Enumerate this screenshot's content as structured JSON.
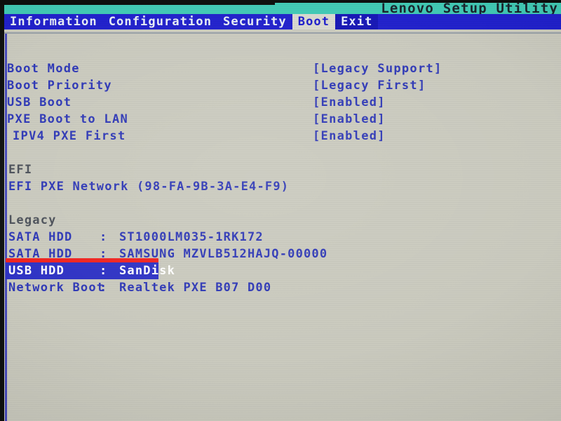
{
  "window": {
    "title": "Lenovo Setup Utility"
  },
  "menu": {
    "items": [
      {
        "label": "Information",
        "state": "normal"
      },
      {
        "label": "Configuration",
        "state": "normal"
      },
      {
        "label": "Security",
        "state": "normal"
      },
      {
        "label": "Boot",
        "state": "active"
      },
      {
        "label": "Exit",
        "state": "focus"
      }
    ]
  },
  "settings": [
    {
      "label": "Boot Mode",
      "value": "[Legacy Support]"
    },
    {
      "label": "Boot Priority",
      "value": "[Legacy First]"
    },
    {
      "label": "USB Boot",
      "value": "[Enabled]"
    },
    {
      "label": "PXE Boot to LAN",
      "value": "[Enabled]"
    },
    {
      "label": "IPV4 PXE First",
      "value": "[Enabled]"
    }
  ],
  "efi": {
    "heading": "EFI",
    "entries": [
      {
        "text": "EFI PXE Network (98-FA-9B-3A-E4-F9)"
      }
    ]
  },
  "legacy": {
    "heading": "Legacy",
    "entries": [
      {
        "name": "SATA HDD",
        "colon": ":",
        "device": "ST1000LM035-1RK172",
        "selected": false
      },
      {
        "name": "SATA HDD",
        "colon": ":",
        "device": "SAMSUNG MZVLB512HAJQ-00000",
        "selected": false
      },
      {
        "name": "USB HDD",
        "colon": ":",
        "device": "SanDisk",
        "selected": true
      },
      {
        "name": "Network Boot",
        "colon": ":",
        "device": "Realtek PXE B07 D00",
        "selected": false
      }
    ]
  },
  "annotation": {
    "color": "#f0201c",
    "target": "USB HDD : SanDisk"
  },
  "colors": {
    "title_band": "#3fc9b4",
    "menu_bar": "#1e1ecb",
    "screen_background": "#c9c9bd",
    "text_blue": "#2b35b5",
    "highlight": "#2b2fc4",
    "section_heading": "#4a4f58"
  }
}
